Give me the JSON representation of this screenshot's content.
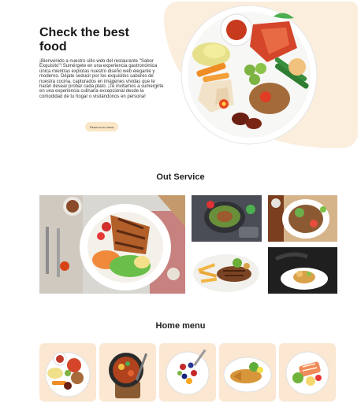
{
  "hero": {
    "title": "Check the best food",
    "description": "¡Bienvenido a nuestro sitio web del restaurante \"Sabor Exquisito\"! Sumérgete en una experiencia gastronómica única mientras exploras nuestro diseño web elegante y moderno. Déjate seducir por los exquisitos sabores de nuestra cocina, capturados en imágenes vívidas que te harán desear probar cada plato. ¡Te invitamos a sumergirte en una experiencia culinaria excepcional desde la comodidad de tu hogar o visitándonos en persona!",
    "button_label": "Reserva tu mesa"
  },
  "services": {
    "title": "Out Service",
    "images": [
      {
        "name": "grilled-chicken-salad-photo"
      },
      {
        "name": "salad-bowl-photo"
      },
      {
        "name": "beef-salad-photo"
      },
      {
        "name": "steak-fries-photo"
      },
      {
        "name": "plated-dish-dark-photo"
      }
    ]
  },
  "home_menu": {
    "title": "Home menu",
    "items": [
      {
        "name": "menu-item-mixed-plate"
      },
      {
        "name": "menu-item-skillet-dish"
      },
      {
        "name": "menu-item-berry-salad"
      },
      {
        "name": "menu-item-fried-fish"
      },
      {
        "name": "menu-item-salmon-plate"
      }
    ]
  },
  "colors": {
    "accent": "#fbeedd",
    "button": "#fbe6c6",
    "card": "#fbe7d2"
  }
}
